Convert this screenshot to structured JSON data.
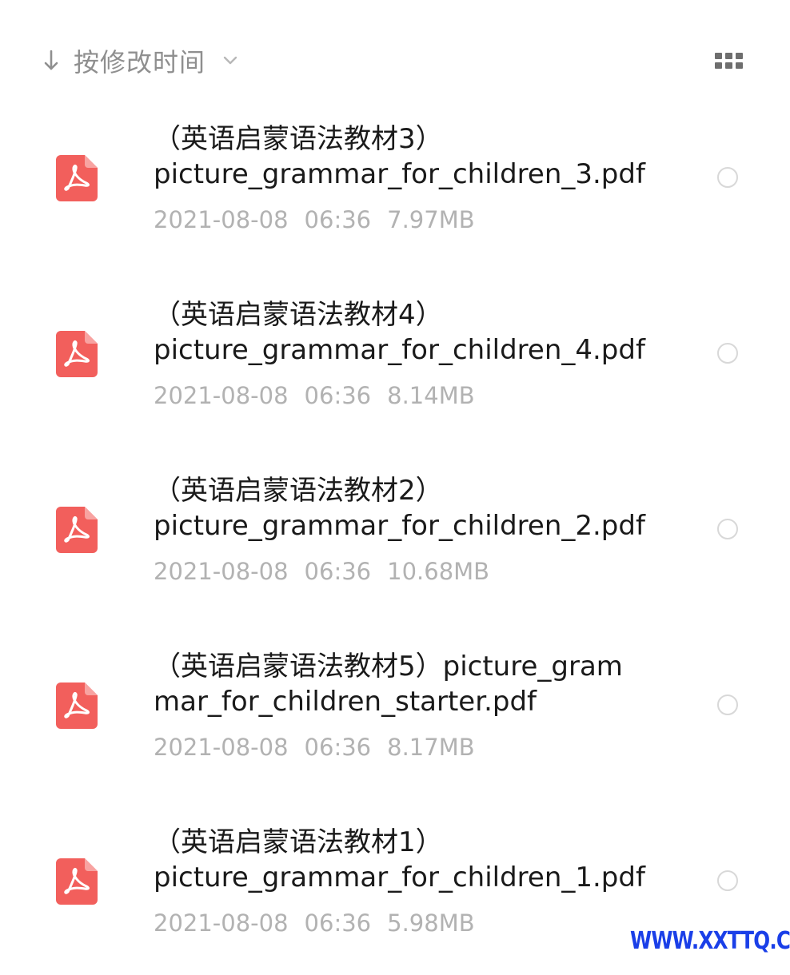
{
  "toolbar": {
    "sort_label": "按修改时间",
    "sort_icon": "arrow-down-icon",
    "dropdown_icon": "chevron-down-icon",
    "view_toggle_icon": "grid-view-icon"
  },
  "colors": {
    "pdf_icon": "#f25f5c",
    "meta_text": "#b2b2b2",
    "watermark": "#1a3fe8"
  },
  "files": [
    {
      "name": "（英语启蒙语法教材3）\npicture_grammar_for_children_3.pdf",
      "date": "2021-08-08",
      "time": "06:36",
      "size": "7.97MB",
      "icon": "pdf-icon",
      "selected": false
    },
    {
      "name": "（英语启蒙语法教材4）\npicture_grammar_for_children_4.pdf",
      "date": "2021-08-08",
      "time": "06:36",
      "size": "8.14MB",
      "icon": "pdf-icon",
      "selected": false
    },
    {
      "name": "（英语启蒙语法教材2）\npicture_grammar_for_children_2.pdf",
      "date": "2021-08-08",
      "time": "06:36",
      "size": "10.68MB",
      "icon": "pdf-icon",
      "selected": false
    },
    {
      "name": "（英语启蒙语法教材5）picture_gram\nmar_for_children_starter.pdf",
      "date": "2021-08-08",
      "time": "06:36",
      "size": "8.17MB",
      "icon": "pdf-icon",
      "selected": false
    },
    {
      "name": "（英语启蒙语法教材1）\npicture_grammar_for_children_1.pdf",
      "date": "2021-08-08",
      "time": "06:36",
      "size": "5.98MB",
      "icon": "pdf-icon",
      "selected": false
    }
  ],
  "watermark": {
    "text": "WWW.XXTTQ.COM"
  }
}
